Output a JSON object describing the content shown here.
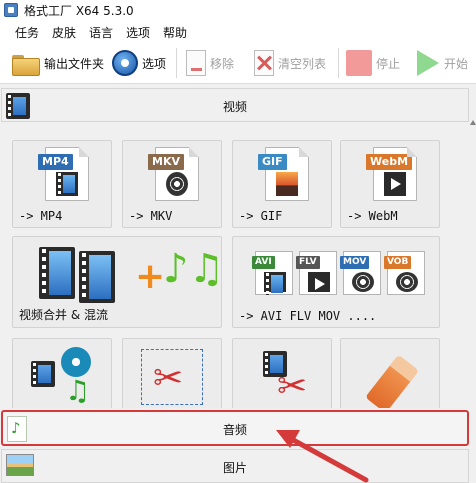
{
  "window": {
    "title": "格式工厂 X64 5.3.0"
  },
  "menu": [
    "任务",
    "皮肤",
    "语言",
    "选项",
    "帮助"
  ],
  "toolbar": {
    "output_folder": "输出文件夹",
    "options": "选项",
    "remove": "移除",
    "clear_list": "清空列表",
    "stop": "停止",
    "start": "开始"
  },
  "categories": {
    "video": "视频",
    "audio": "音频",
    "picture": "图片"
  },
  "tiles": [
    {
      "badge": "MP4",
      "badge_color": "#2f6db3",
      "label": "-> MP4"
    },
    {
      "badge": "MKV",
      "badge_color": "#8a6a4a",
      "label": "-> MKV"
    },
    {
      "badge": "GIF",
      "badge_color": "#3a8ac4",
      "label": "-> GIF"
    },
    {
      "badge": "WebM",
      "badge_color": "#d9782a",
      "label": "-> WebM"
    }
  ],
  "wide_tiles": [
    {
      "label": "视频合并 & 混流"
    },
    {
      "label": "-> AVI FLV MOV ....",
      "badges": [
        "AVI",
        "FLV",
        "MOV",
        "VOB"
      ]
    }
  ],
  "colors": {
    "highlight_border": "#d43a3a",
    "arrow": "#d43a3a"
  }
}
